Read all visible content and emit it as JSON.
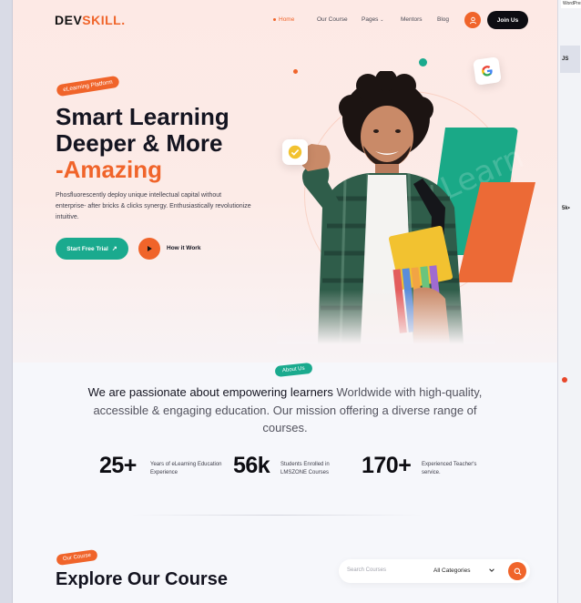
{
  "brand": {
    "logo_main": "DEV",
    "logo_accent": "SKILL",
    "logo_dot": ".",
    "accent_color": "#f0642a",
    "teal_color": "#1aaa8e"
  },
  "nav": {
    "items": [
      {
        "label": "Home",
        "active": true
      },
      {
        "label": "Our Course"
      },
      {
        "label": "Pages"
      },
      {
        "label": "Mentors"
      },
      {
        "label": "Blog"
      }
    ],
    "join_label": "Join Us"
  },
  "hero": {
    "badge": "eLearning Platform",
    "title_line1": "Smart Learning",
    "title_line2": "Deeper & More",
    "title_line3": "-Amazing",
    "description": "Phosfluorescently deploy unique intellectual capital without enterprise- after bricks & clicks synergy. Enthusiastically revolutionize intuitive.",
    "cta_primary": "Start Free Trial",
    "cta_secondary": "How it Work",
    "art_word": "Learn"
  },
  "about": {
    "badge": "About Us",
    "mission_strong": "We are passionate about empowering learners",
    "mission_rest": " Worldwide with high-quality, accessible & engaging education. Our mission offering a diverse range of courses."
  },
  "stats": [
    {
      "value": "25+",
      "label": "Years of eLearning Education Experience"
    },
    {
      "value": "56k",
      "label": "Students Enrolled in LMSZONE Courses"
    },
    {
      "value": "170+",
      "label": "Experienced Teacher's service."
    }
  ],
  "courses": {
    "badge": "Our Course",
    "title": "Explore Our Course",
    "search_placeholder": "Search Courses",
    "category_selected": "All Categories"
  },
  "side_panel": {
    "top_text": "WordPres",
    "text_1": "JS",
    "text_2": "5k•"
  }
}
